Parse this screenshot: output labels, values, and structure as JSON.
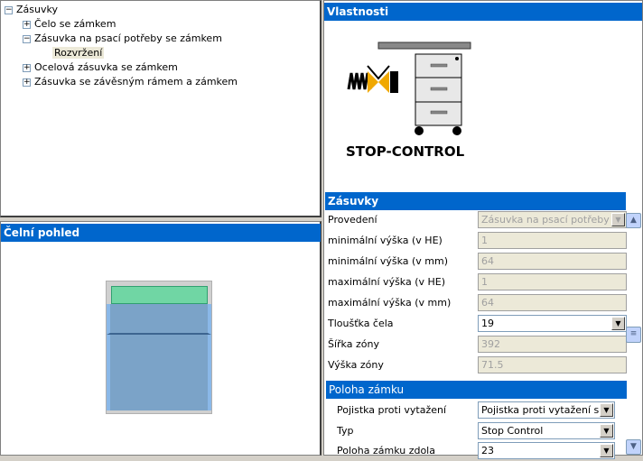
{
  "tree": {
    "root": "Zásuvky",
    "items": [
      {
        "label": "Čelo se zámkem",
        "expanded": false
      },
      {
        "label": "Zásuvka na psací potřeby se zámkem",
        "expanded": true,
        "children": [
          "Rozvržení"
        ]
      },
      {
        "label": "Ocelová zásuvka se zámkem",
        "expanded": false
      },
      {
        "label": "Zásuvka se závěsným rámem a zámkem",
        "expanded": false
      }
    ]
  },
  "front_view": {
    "title": "Čelní pohled",
    "colors": {
      "top_zone": "#70d6a4",
      "drawer": "#7ba3c8"
    }
  },
  "properties": {
    "title": "Vlastnosti",
    "logo_text": "STOP-CONTROL",
    "section1": {
      "title": "Zásuvky",
      "rows": [
        {
          "label": "Provedení",
          "value": "Zásuvka na psací potřeby",
          "type": "select",
          "enabled": false
        },
        {
          "label": "minimální výška (v HE)",
          "value": "1",
          "enabled": false
        },
        {
          "label": "minimální výška (v mm)",
          "value": "64",
          "enabled": false
        },
        {
          "label": "maximální výška (v HE)",
          "value": "1",
          "enabled": false
        },
        {
          "label": "maximální výška (v mm)",
          "value": "64",
          "enabled": false
        },
        {
          "label": "Tloušťka čela",
          "value": "19",
          "type": "select",
          "enabled": true
        },
        {
          "label": "Šířka zóny",
          "value": "392",
          "enabled": false
        },
        {
          "label": "Výška zóny",
          "value": "71.5",
          "enabled": false
        }
      ]
    },
    "section2": {
      "title": "Poloha zámku",
      "rows": [
        {
          "label": "Pojistka proti vytažení",
          "value": "Pojistka proti vytažení se zá",
          "type": "select"
        },
        {
          "label": "Typ",
          "value": "Stop Control",
          "type": "select"
        },
        {
          "label": "Poloha zámku zdola",
          "value": "23",
          "type": "select"
        }
      ]
    }
  }
}
